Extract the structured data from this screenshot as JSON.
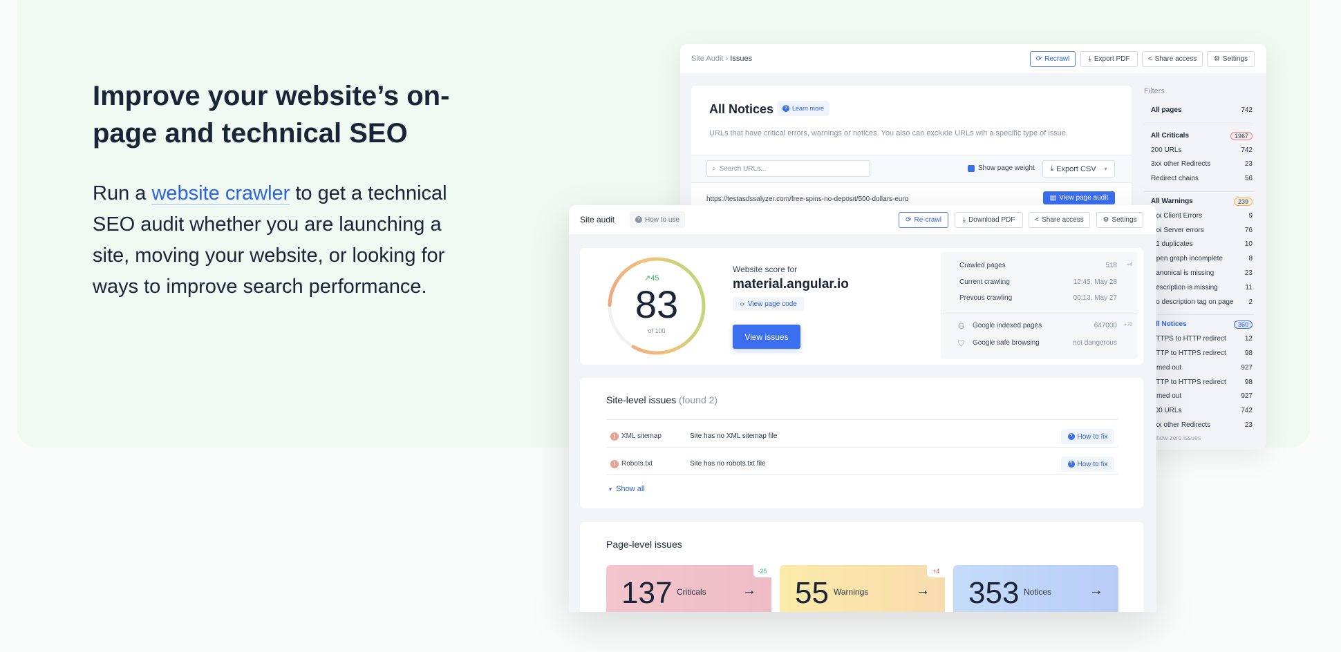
{
  "hero": {
    "title": "Improve your website’s on-page and technical SEO",
    "text_before": "Run a ",
    "link": "website crawler",
    "text_after": " to get a technical SEO audit whether you are launching a site, moving your website, or looking for ways to improve search performance."
  },
  "back": {
    "breadcrumb": {
      "parent": "Site Audit",
      "sep": "›",
      "current": "Issues"
    },
    "buttons": {
      "recrawl": "Recrawl",
      "export_pdf": "Export PDF",
      "share": "Share access",
      "settings": "Settings"
    },
    "title": "All Notices",
    "learn_more": "Learn more",
    "description": "URLs that have critical errors, warnings or notices. You also can exclude URLs wih a specific type of issue.",
    "search_placeholder": "Search URLs...",
    "show_weight": "Show page weight",
    "export_csv": "Export CSV",
    "url": "https://testasdssalyzer.com/free-spins-no-deposit/500-dollars-euro",
    "view_audit": "View page audit",
    "filters": {
      "label": "Filters",
      "all_pages": {
        "label": "All pages",
        "count": "742"
      },
      "criticals": {
        "label": "All Criticals",
        "count": "1967",
        "items": [
          {
            "label": "200 URLs",
            "count": "742"
          },
          {
            "label": "3xx other Redirects",
            "count": "23"
          },
          {
            "label": "Redirect chains",
            "count": "56"
          }
        ]
      },
      "warnings": {
        "label": "All Warnings",
        "count": "239",
        "items": [
          {
            "label": "4xx Client Errors",
            "count": "9"
          },
          {
            "label": "5xx Server errors",
            "count": "76"
          },
          {
            "label": "H1 duplicates",
            "count": "10"
          },
          {
            "label": "Open graph incomplete",
            "count": "8"
          },
          {
            "label": "Canonical is missing",
            "count": "23"
          },
          {
            "label": "Description is missing",
            "count": "11"
          },
          {
            "label": "No description tag on page",
            "count": "2"
          }
        ]
      },
      "notices": {
        "label": "All Notices",
        "count": "360",
        "items": [
          {
            "label": "HTTPS to HTTP redirect",
            "count": "12"
          },
          {
            "label": "HTTP to HTTPS redirect",
            "count": "98"
          },
          {
            "label": "Timed out",
            "count": "927"
          },
          {
            "label": "HTTP to HTTPS redirect",
            "count": "98"
          },
          {
            "label": "Timed out",
            "count": "927"
          },
          {
            "label": "200 URLs",
            "count": "742"
          },
          {
            "label": "3xx other Redirects",
            "count": "23"
          }
        ]
      },
      "show_zero": "Show zero issues"
    }
  },
  "front": {
    "title": "Site audit",
    "how_to_use": "How to use",
    "buttons": {
      "recrawl": "Re-crawl",
      "download_pdf": "Download PDF",
      "share": "Share access",
      "settings": "Settings"
    },
    "score": {
      "value": "83",
      "of": "of 100",
      "trend": "45",
      "fraction": 0.83,
      "label": "Website score for",
      "site": "material.angular.io",
      "view_code": "View page code",
      "view_issues": "View issues"
    },
    "stats": [
      {
        "label": "Crawled pages",
        "value": "518",
        "delta": "+4"
      },
      {
        "label": "Current crawling",
        "value": "12:45, May 28"
      },
      {
        "label": "Prevous crawling",
        "value": "00:13, May 27"
      }
    ],
    "google": [
      {
        "label": "Google indexed pages",
        "value": "647000",
        "delta": "+70"
      },
      {
        "label": "Google safe browsing",
        "value": "not dangerous"
      }
    ],
    "site_issues": {
      "title": "Site-level issues",
      "found": "(found 2)",
      "rows": [
        {
          "name": "XML sitemap",
          "desc": "Site has no XML sitemap file",
          "fix": "How to fix"
        },
        {
          "name": "Robots.txt",
          "desc": "Site has no robots.txt file",
          "fix": "How to fix"
        }
      ],
      "show_all": "Show all"
    },
    "page_issues": {
      "title": "Page-level issues",
      "tiles": [
        {
          "num": "137",
          "label": "Criticals",
          "delta": "-25"
        },
        {
          "num": "55",
          "label": "Warnings",
          "delta": "+4"
        },
        {
          "num": "353",
          "label": "Notices"
        }
      ]
    }
  },
  "colors": {
    "accent": "#3b6ff0",
    "critical": "#e98b7e",
    "warning": "#f0b34a",
    "hero_bg": "#f0faf3"
  }
}
